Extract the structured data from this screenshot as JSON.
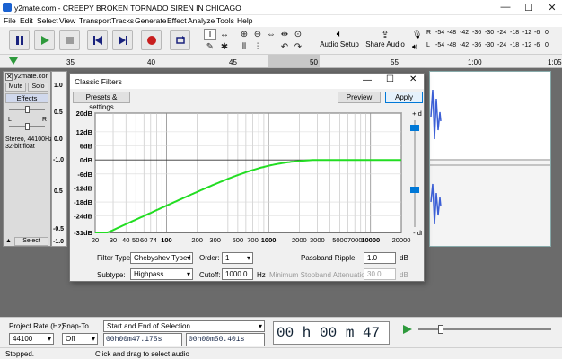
{
  "window": {
    "title": "y2mate.com - CREEPY BROKEN TORNADO SIREN IN CHICAGO"
  },
  "menu": [
    "File",
    "Edit",
    "Select",
    "View",
    "Transport",
    "Tracks",
    "Generate",
    "Effect",
    "Analyze",
    "Tools",
    "Help"
  ],
  "toolbar": {
    "audio_setup": "Audio Setup",
    "share_audio": "Share Audio",
    "meter_ticks": [
      "-54",
      "-48",
      "-42",
      "-36",
      "-30",
      "-24",
      "-18",
      "-12",
      "-6",
      "0"
    ],
    "meter_l": "L",
    "meter_r": "R"
  },
  "ruler": {
    "ticks": [
      "35",
      "40",
      "45",
      "50",
      "55",
      "1:00",
      "1:05"
    ]
  },
  "track": {
    "name": "y2mate.com",
    "mute": "Mute",
    "solo": "Solo",
    "effects": "Effects",
    "left": "L",
    "right": "R",
    "info1": "Stereo, 44100Hz",
    "info2": "32-bit float",
    "select": "Select",
    "scale": [
      "1.0",
      "0.5",
      "0.0",
      "-0.5",
      "-1.0",
      "0.5",
      "0.0",
      "-0.5",
      "-1.0"
    ]
  },
  "dialog": {
    "title": "Classic Filters",
    "presets": "Presets & settings",
    "preview": "Preview",
    "apply": "Apply",
    "db_labels": [
      "20dB",
      "12dB",
      "6dB",
      "0dB",
      "-6dB",
      "-12dB",
      "-18dB",
      "-24dB",
      "-31dB"
    ],
    "freq_labels": [
      "20",
      "30",
      "40",
      "50",
      "60",
      "74",
      "100",
      "200",
      "300",
      "500",
      "700",
      "1000",
      "2000",
      "3000",
      "5000",
      "7000",
      "10000",
      "20000"
    ],
    "slider_top": "+ dB",
    "slider_bot": "- dB",
    "filter_type_label": "Filter Type:",
    "filter_type": "Chebyshev Type I",
    "order_label": "Order:",
    "order": "1",
    "ripple_label": "Passband Ripple:",
    "ripple": "1.0",
    "ripple_unit": "dB",
    "subtype_label": "Subtype:",
    "subtype": "Highpass",
    "cutoff_label": "Cutoff:",
    "cutoff": "1000.0",
    "cutoff_unit": "Hz",
    "stopband_label": "Minimum Stopband Attenuation:",
    "stopband": "30.0",
    "stopband_unit": "dB"
  },
  "bottom": {
    "project_rate_label": "Project Rate (Hz)",
    "project_rate": "44100",
    "snap_label": "Snap-To",
    "snap": "Off",
    "selection_mode": "Start and End of Selection",
    "sel_start": "00h00m47.175s",
    "sel_end": "00h00m50.401s",
    "time_big": "00 h 00 m 47 s"
  },
  "status": {
    "left": "Stopped.",
    "right": "Click and drag to select audio"
  },
  "colors": {
    "accent": "#0078d7",
    "curve": "#22dd22",
    "wave": "#3c5fd6",
    "play": "#2e9a3c",
    "record": "#c81e1e"
  }
}
